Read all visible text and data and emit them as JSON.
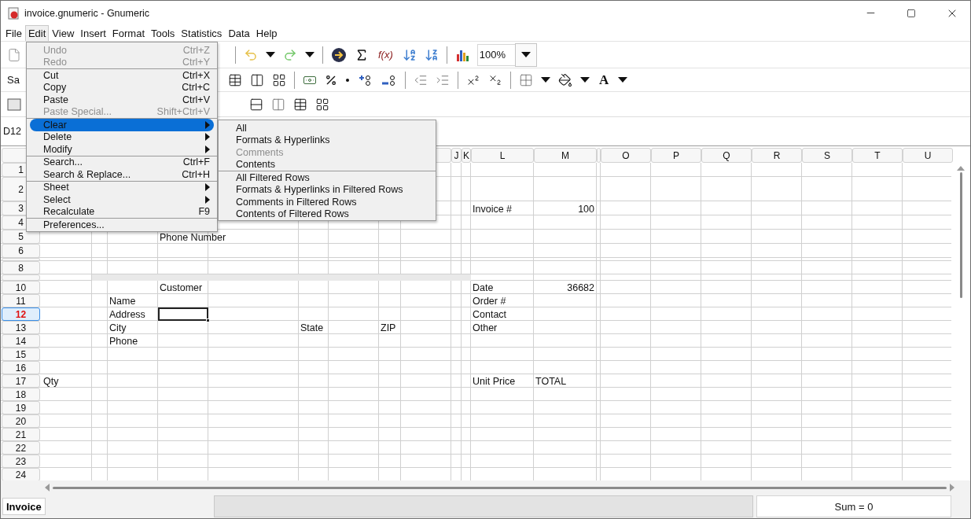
{
  "window": {
    "title": "invoice.gnumeric - Gnumeric"
  },
  "menu_bar": [
    {
      "label": "File",
      "selected": false
    },
    {
      "label": "Edit",
      "selected": true
    },
    {
      "label": "View",
      "selected": false
    },
    {
      "label": "Insert",
      "selected": false
    },
    {
      "label": "Format",
      "selected": false
    },
    {
      "label": "Tools",
      "selected": false
    },
    {
      "label": "Statistics",
      "selected": false
    },
    {
      "label": "Data",
      "selected": false
    },
    {
      "label": "Help",
      "selected": false
    }
  ],
  "toolbar": {
    "zoom": "100%",
    "function_label": "f(x)",
    "font_name": "Sa",
    "font_color_label": "A"
  },
  "formula_bar": {
    "cell_ref": "D12"
  },
  "column_headers": [
    {
      "kind": "hidden"
    },
    {
      "kind": "hidden"
    },
    {
      "kind": "hidden"
    },
    {
      "kind": "hidden"
    },
    {
      "kind": "hidden"
    },
    {
      "kind": "hidden"
    },
    {
      "kind": "hidden"
    },
    {
      "kind": "hidden"
    },
    {
      "kind": "blank"
    },
    {
      "kind": "label",
      "label": "J"
    },
    {
      "kind": "label",
      "label": "K"
    },
    {
      "kind": "label",
      "label": "L"
    },
    {
      "kind": "label",
      "label": "M"
    },
    {
      "kind": "blank"
    },
    {
      "kind": "label",
      "label": "O"
    },
    {
      "kind": "label",
      "label": "P"
    },
    {
      "kind": "label",
      "label": "Q"
    },
    {
      "kind": "label",
      "label": "R"
    },
    {
      "kind": "label",
      "label": "S"
    },
    {
      "kind": "label",
      "label": "T"
    },
    {
      "kind": "label",
      "label": "U"
    }
  ],
  "rows": [
    {
      "label": "1",
      "kind": "normal",
      "selected": false
    },
    {
      "label": "2",
      "kind": "tall",
      "selected": false
    },
    {
      "label": "3",
      "kind": "normal",
      "selected": false,
      "cells": [
        null,
        null,
        null,
        null,
        null,
        null,
        null,
        null,
        null,
        null,
        null,
        "Invoice #",
        {
          "text": "100",
          "kind": "number"
        }
      ]
    },
    {
      "label": "4",
      "kind": "normal",
      "selected": false
    },
    {
      "label": "5",
      "kind": "normal",
      "selected": false,
      "cells": [
        null,
        null,
        null,
        "Phone Number"
      ]
    },
    {
      "label": "6",
      "kind": "normal",
      "selected": false
    },
    {
      "kind": "short",
      "selected": false
    },
    {
      "label": "8",
      "kind": "normal",
      "selected": false
    },
    {
      "kind": "band",
      "selected": false
    },
    {
      "label": "10",
      "kind": "normal",
      "selected": false,
      "cells": [
        null,
        null,
        null,
        "Customer",
        null,
        null,
        null,
        null,
        null,
        null,
        null,
        "Date",
        {
          "text": "36682",
          "kind": "number"
        }
      ]
    },
    {
      "label": "11",
      "kind": "normal",
      "selected": false,
      "cells": [
        null,
        null,
        "Name",
        null,
        null,
        null,
        null,
        null,
        null,
        null,
        null,
        "Order #"
      ]
    },
    {
      "label": "12",
      "kind": "normal",
      "selected": true,
      "cells": [
        null,
        null,
        "Address",
        {
          "selected": true
        },
        null,
        null,
        null,
        null,
        null,
        null,
        null,
        "Contact"
      ]
    },
    {
      "label": "13",
      "kind": "normal",
      "selected": false,
      "cells": [
        null,
        null,
        "City",
        null,
        null,
        "State",
        null,
        "ZIP",
        null,
        null,
        null,
        "Other"
      ]
    },
    {
      "label": "14",
      "kind": "normal",
      "selected": false,
      "cells": [
        null,
        null,
        "Phone"
      ]
    },
    {
      "label": "15",
      "kind": "normal",
      "selected": false
    },
    {
      "label": "16",
      "kind": "normal",
      "selected": false
    },
    {
      "label": "17",
      "kind": "normal",
      "selected": false,
      "cells": [
        "Qty",
        null,
        null,
        null,
        null,
        null,
        null,
        null,
        null,
        null,
        null,
        "Unit Price",
        "TOTAL"
      ]
    },
    {
      "label": "18",
      "kind": "normal",
      "selected": false
    },
    {
      "label": "19",
      "kind": "normal",
      "selected": false
    },
    {
      "label": "20",
      "kind": "normal",
      "selected": false
    },
    {
      "label": "21",
      "kind": "normal",
      "selected": false
    },
    {
      "label": "22",
      "kind": "normal",
      "selected": false
    },
    {
      "label": "23",
      "kind": "normal",
      "selected": false
    },
    {
      "label": "24",
      "kind": "normal",
      "selected": false
    }
  ],
  "edit_menu": [
    {
      "kind": "item",
      "label": "Undo",
      "shortcut": "Ctrl+Z",
      "disabled": true,
      "submenu": false,
      "selected": false
    },
    {
      "kind": "item",
      "label": "Redo",
      "shortcut": "Ctrl+Y",
      "disabled": true,
      "submenu": false,
      "selected": false
    },
    {
      "kind": "separator"
    },
    {
      "kind": "item",
      "label": "Cut",
      "shortcut": "Ctrl+X",
      "disabled": false,
      "submenu": false,
      "selected": false
    },
    {
      "kind": "item",
      "label": "Copy",
      "shortcut": "Ctrl+C",
      "disabled": false,
      "submenu": false,
      "selected": false
    },
    {
      "kind": "item",
      "label": "Paste",
      "shortcut": "Ctrl+V",
      "disabled": false,
      "submenu": false,
      "selected": false
    },
    {
      "kind": "item",
      "label": "Paste Special...",
      "shortcut": "Shift+Ctrl+V",
      "disabled": true,
      "submenu": false,
      "selected": false
    },
    {
      "kind": "separator"
    },
    {
      "kind": "item",
      "label": "Clear",
      "disabled": false,
      "submenu": true,
      "selected": true
    },
    {
      "kind": "item",
      "label": "Delete",
      "disabled": false,
      "submenu": true,
      "selected": false
    },
    {
      "kind": "item",
      "label": "Modify",
      "disabled": false,
      "submenu": true,
      "selected": false
    },
    {
      "kind": "separator"
    },
    {
      "kind": "item",
      "label": "Search...",
      "shortcut": "Ctrl+F",
      "disabled": false,
      "submenu": false,
      "selected": false
    },
    {
      "kind": "item",
      "label": "Search & Replace...",
      "shortcut": "Ctrl+H",
      "disabled": false,
      "submenu": false,
      "selected": false
    },
    {
      "kind": "separator"
    },
    {
      "kind": "item",
      "label": "Sheet",
      "disabled": false,
      "submenu": true,
      "selected": false
    },
    {
      "kind": "item",
      "label": "Select",
      "disabled": false,
      "submenu": true,
      "selected": false
    },
    {
      "kind": "item",
      "label": "Recalculate",
      "shortcut": "F9",
      "disabled": false,
      "submenu": false,
      "selected": false
    },
    {
      "kind": "separator"
    },
    {
      "kind": "item",
      "label": "Preferences...",
      "disabled": false,
      "submenu": false,
      "selected": false
    }
  ],
  "clear_submenu": [
    {
      "kind": "item",
      "label": "All",
      "disabled": false
    },
    {
      "kind": "item",
      "label": "Formats & Hyperlinks",
      "disabled": false
    },
    {
      "kind": "item",
      "label": "Comments",
      "disabled": true
    },
    {
      "kind": "item",
      "label": "Contents",
      "disabled": false
    },
    {
      "kind": "separator"
    },
    {
      "kind": "item",
      "label": "All Filtered Rows",
      "disabled": false
    },
    {
      "kind": "item",
      "label": "Formats & Hyperlinks in Filtered Rows",
      "disabled": false
    },
    {
      "kind": "item",
      "label": "Comments in Filtered Rows",
      "disabled": false
    },
    {
      "kind": "item",
      "label": "Contents of Filtered Rows",
      "disabled": false
    }
  ],
  "sheet_tabs": [
    {
      "label": "Invoice",
      "selected": true
    }
  ],
  "status_bar": {
    "sum": "Sum = 0"
  }
}
